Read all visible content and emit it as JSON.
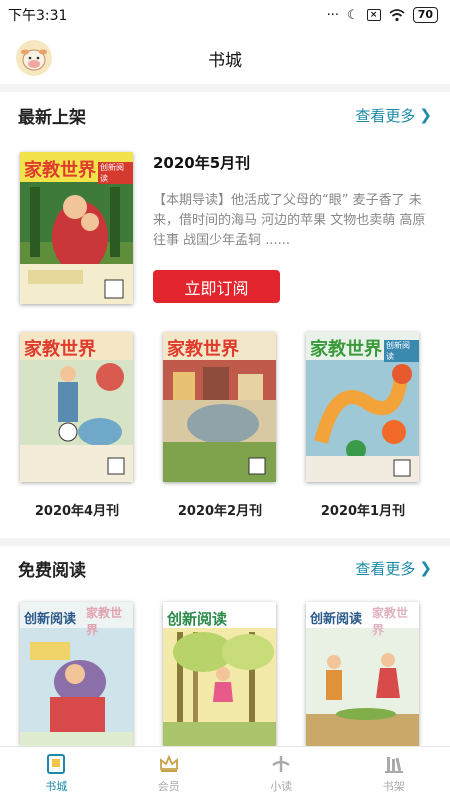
{
  "status": {
    "time": "下午3:31",
    "battery": "70"
  },
  "header": {
    "title": "书城"
  },
  "latest": {
    "title": "最新上架",
    "more": "查看更多",
    "featured": {
      "issue": "2020年5月刊",
      "description": "【本期导读】他活成了父母的“眼” 麦子香了 未来，借时间的海马 河边的苹果 文物也卖萌 高原往事 战国少年孟轲 ......",
      "subscribe": "立即订阅",
      "masthead": "家教世界",
      "sub_masthead": "创新阅读"
    },
    "issues": [
      {
        "label": "2020年4月刊",
        "masthead": "家教世界"
      },
      {
        "label": "2020年2月刊",
        "masthead": "家教世界"
      },
      {
        "label": "2020年1月刊",
        "masthead": "家教世界",
        "sub_masthead": "创新阅读"
      }
    ]
  },
  "free": {
    "title": "免费阅读",
    "more": "查看更多",
    "items": [
      {
        "masthead": "创新阅读",
        "secondary": "家教世界"
      },
      {
        "masthead": "创新阅读"
      },
      {
        "masthead": "创新阅读",
        "secondary": "家教世界"
      }
    ]
  },
  "tabs": [
    {
      "label": "书城",
      "icon": "book-icon",
      "active": true
    },
    {
      "label": "会员",
      "icon": "crown-icon",
      "active": false
    },
    {
      "label": "小读",
      "icon": "pen-icon",
      "active": false
    },
    {
      "label": "书架",
      "icon": "shelf-icon",
      "active": false
    }
  ],
  "colors": {
    "accent": "#1a8aa8",
    "subscribe": "#e3262d"
  }
}
